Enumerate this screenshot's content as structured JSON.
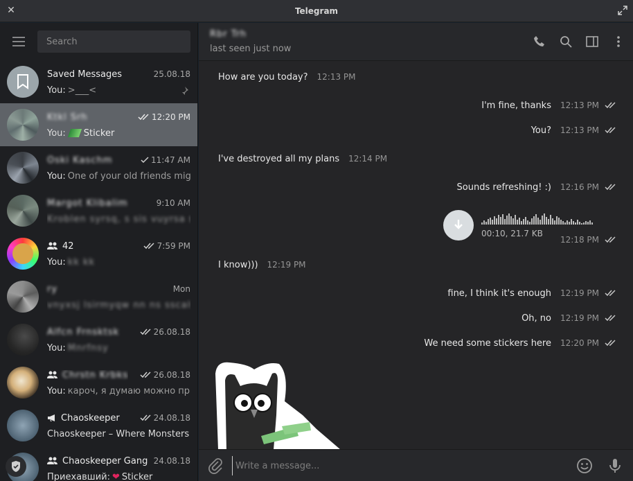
{
  "window": {
    "title": "Telegram"
  },
  "sidebar": {
    "search_placeholder": "Search",
    "chats": [
      {
        "name": "Saved Messages",
        "time": "25.08.18",
        "prefix": "You:",
        "preview": ">___<",
        "pinned": true
      },
      {
        "name": "Ktkl Srh",
        "time": "12:20 PM",
        "prefix": "You:",
        "preview": "Sticker",
        "read": true,
        "active": true
      },
      {
        "name": "Oski Kaschm",
        "time": "11:47 AM",
        "prefix": "You:",
        "preview": "One of your old friends mig...",
        "sent": true
      },
      {
        "name": "Margot Klibalim",
        "time": "9:10 AM",
        "prefix": "",
        "preview": "Kroblen syrsq, s sis vuyrsa svyscs..."
      },
      {
        "name": "42",
        "time": "7:59 PM",
        "prefix": "You:",
        "preview": "kk kk",
        "read": true,
        "group": true
      },
      {
        "name": "ry",
        "time": "Mon",
        "prefix": "",
        "preview": "vnyxsj lsirmyqw nn ns sscalshh ..."
      },
      {
        "name": "Alfcn Frnsktsk",
        "time": "26.08.18",
        "prefix": "You:",
        "preview": "Mnrfnsy",
        "read": true
      },
      {
        "name": "Chrstn Krbks",
        "time": "26.08.18",
        "prefix": "You:",
        "preview": "кароч, я думаю можно пр...",
        "read": true,
        "group": true
      },
      {
        "name": "Chaoskeeper",
        "time": "24.08.18",
        "prefix": "",
        "preview": "Chaoskeeper – Where Monsters ...",
        "read": true,
        "channel": true
      },
      {
        "name": "Chaoskeeper Gang",
        "time": "24.08.18",
        "prefix": "Приехавший:",
        "preview": "Sticker",
        "group": true
      }
    ]
  },
  "chat": {
    "peer_name": "Rbr Trh",
    "peer_status": "last seen just now",
    "composer_placeholder": "Write a message...",
    "messages": [
      {
        "text": "How are you today?",
        "time": "12:13 PM",
        "out": false
      },
      {
        "text": "I'm fine, thanks",
        "time": "12:13 PM",
        "out": true
      },
      {
        "text": "You?",
        "time": "12:13 PM",
        "out": true
      },
      {
        "text": "I've destroyed all my plans",
        "time": "12:14 PM",
        "out": false
      },
      {
        "text": "Sounds refreshing! :)",
        "time": "12:16 PM",
        "out": true
      },
      {
        "text": "I know)))",
        "time": "12:19 PM",
        "out": false
      },
      {
        "text": "fine, I think it's enough",
        "time": "12:19 PM",
        "out": true
      },
      {
        "text": "Oh, no",
        "time": "12:19 PM",
        "out": true
      },
      {
        "text": "We need some stickers here",
        "time": "12:20 PM",
        "out": true
      }
    ],
    "voice": {
      "info": "00:10, 21.7 KB",
      "time": "12:18 PM"
    }
  },
  "colors": {
    "sidebar_bg": "#1e1f22",
    "active_chat": "#5f6368",
    "chat_bg": "#252527",
    "accent": "#d9dde0"
  }
}
